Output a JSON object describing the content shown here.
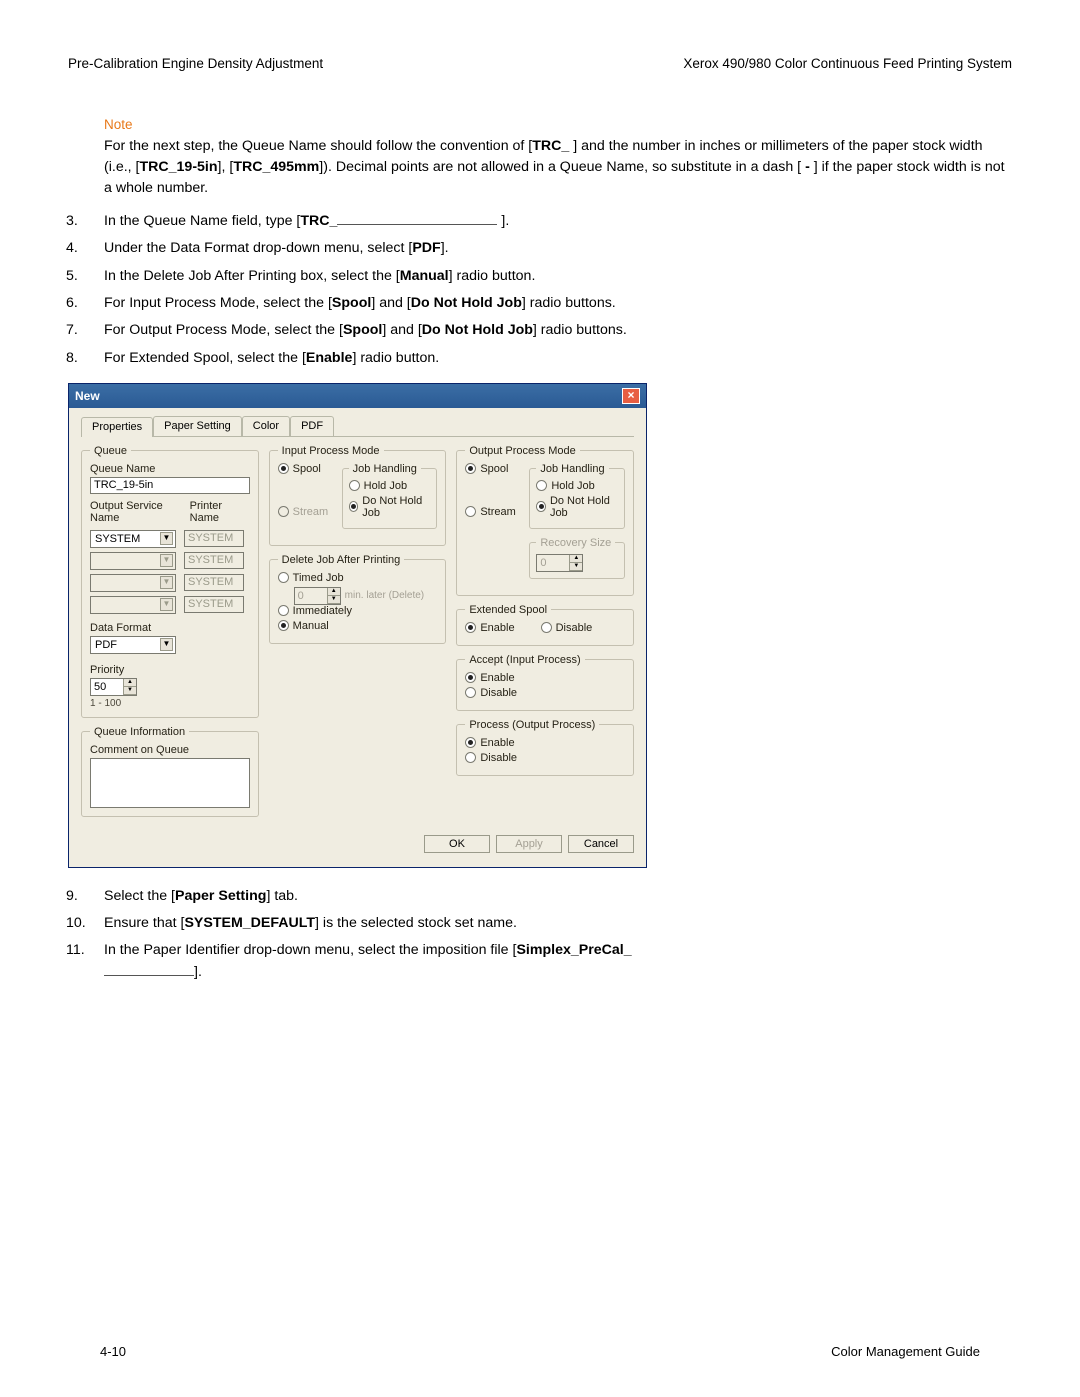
{
  "header": {
    "left": "Pre-Calibration Engine Density Adjustment",
    "right": "Xerox 490/980 Color Continuous Feed Printing System"
  },
  "note": {
    "label": "Note",
    "body_p1": "For the next step, the Queue Name should follow the convention of [",
    "body_b1": "TRC_",
    "body_p2": " ] and the number in inches or millimeters of the paper stock width (i.e., [",
    "body_b2": "TRC_19-5in",
    "body_p3": "], [",
    "body_b3": "TRC_495mm",
    "body_p4": "]). Decimal points are not allowed in a Queue Name, so substitute in a dash [ ",
    "body_b4": "-",
    "body_p5": " ] if the paper stock width is not a whole number."
  },
  "steps": {
    "s3": {
      "n": "3.",
      "pre": "In the Queue Name field, type [",
      "b1": "TRC_",
      "post": "]."
    },
    "s4": {
      "n": "4.",
      "pre": "Under the Data Format drop-down menu, select [",
      "b1": "PDF",
      "post": "]."
    },
    "s5": {
      "n": "5.",
      "pre": "In the Delete Job After Printing box, select the [",
      "b1": "Manual",
      "post": "] radio button."
    },
    "s6": {
      "n": "6.",
      "pre": "For Input Process Mode, select the [",
      "b1": "Spool",
      "mid": "] and [",
      "b2": "Do Not Hold Job",
      "post": "] radio buttons."
    },
    "s7": {
      "n": "7.",
      "pre": "For Output Process Mode, select the [",
      "b1": "Spool",
      "mid": "] and [",
      "b2": "Do Not Hold Job",
      "post": "] radio buttons."
    },
    "s8": {
      "n": "8.",
      "pre": "For Extended Spool, select the [",
      "b1": "Enable",
      "post": "] radio button."
    },
    "s9": {
      "n": "9.",
      "pre": "Select the [",
      "b1": "Paper Setting",
      "post": "] tab."
    },
    "s10": {
      "n": "10.",
      "pre": "Ensure that [",
      "b1": "SYSTEM_DEFAULT",
      "post": "] is the selected stock set name."
    },
    "s11": {
      "n": "11.",
      "pre": "In the Paper Identifier drop-down menu, select the imposition file [",
      "b1": "Simplex_PreCal_",
      "post": "]."
    }
  },
  "dialog": {
    "title": "New",
    "tabs": {
      "t1": "Properties",
      "t2": "Paper Setting",
      "t3": "Color",
      "t4": "PDF"
    },
    "queue": {
      "legend": "Queue",
      "name_lbl": "Queue Name",
      "name_val": "TRC_19-5in",
      "out_lbl": "Output Service Name",
      "prn_lbl": "Printer Name",
      "system": "SYSTEM",
      "system_dis": "SYSTEM",
      "fmt_lbl": "Data Format",
      "fmt_val": "PDF",
      "prio_lbl": "Priority",
      "prio_val": "50",
      "prio_range": "1 - 100"
    },
    "qinfo": {
      "legend": "Queue Information",
      "lbl": "Comment on Queue"
    },
    "ipm": {
      "legend": "Input Process Mode",
      "spool": "Spool",
      "stream": "Stream",
      "jh_legend": "Job Handling",
      "hold": "Hold Job",
      "nohold": "Do Not Hold Job"
    },
    "djap": {
      "legend": "Delete Job After Printing",
      "timed": "Timed Job",
      "timed_val": "0",
      "timed_after": "min. later (Delete)",
      "imm": "Immediately",
      "manual": "Manual"
    },
    "opm": {
      "legend": "Output Process Mode",
      "spool": "Spool",
      "stream": "Stream",
      "jh_legend": "Job Handling",
      "hold": "Hold Job",
      "nohold": "Do Not Hold Job",
      "rec_legend": "Recovery Size",
      "rec_val": "0"
    },
    "ext": {
      "legend": "Extended Spool",
      "en": "Enable",
      "dis": "Disable"
    },
    "aip": {
      "legend": "Accept (Input Process)",
      "en": "Enable",
      "dis": "Disable"
    },
    "pop": {
      "legend": "Process (Output Process)",
      "en": "Enable",
      "dis": "Disable"
    },
    "buttons": {
      "ok": "OK",
      "apply": "Apply",
      "cancel": "Cancel"
    }
  },
  "footer": {
    "left": "4-10",
    "right": "Color Management Guide"
  }
}
